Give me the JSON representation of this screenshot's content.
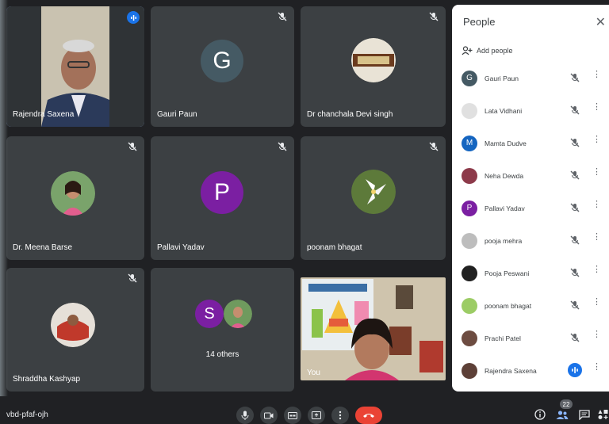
{
  "tiles": [
    {
      "name": "Rajendra Saxena",
      "state": "speaking"
    },
    {
      "name": "Gauri Paun",
      "initial": "G",
      "color": "#455a64"
    },
    {
      "name": "Dr chanchala Devi singh"
    },
    {
      "name": "Dr. Meena Barse"
    },
    {
      "name": "Pallavi Yadav",
      "initial": "P",
      "color": "#7b1fa2"
    },
    {
      "name": "poonam bhagat"
    },
    {
      "name": "Shraddha Kashyap"
    },
    {
      "name": "14 others",
      "initial": "S",
      "color": "#7b1fa2"
    },
    {
      "name": "You"
    }
  ],
  "people_panel": {
    "title": "People",
    "add_label": "Add people",
    "participants": [
      {
        "name": "Gauri Paun",
        "initial": "G",
        "color": "#455a64",
        "muted": true
      },
      {
        "name": "Lata Vidhani",
        "initial": "",
        "color": "#e0e0e0",
        "muted": true
      },
      {
        "name": "Mamta Dudve",
        "initial": "M",
        "color": "#1565c0",
        "muted": true
      },
      {
        "name": "Neha Dewda",
        "initial": "",
        "color": "#8d3a4a",
        "muted": true
      },
      {
        "name": "Pallavi Yadav",
        "initial": "P",
        "color": "#7b1fa2",
        "muted": true
      },
      {
        "name": "pooja mehra",
        "initial": "",
        "color": "#bdbdbd",
        "muted": true
      },
      {
        "name": "Pooja Peswani",
        "initial": "",
        "color": "#212121",
        "muted": true
      },
      {
        "name": "poonam bhagat",
        "initial": "",
        "color": "#9ccc65",
        "muted": true
      },
      {
        "name": "Prachi Patel",
        "initial": "",
        "color": "#6d4c41",
        "muted": true
      },
      {
        "name": "Rajendra Saxena",
        "initial": "",
        "color": "#5d4037",
        "muted": false
      }
    ]
  },
  "bottom_bar": {
    "meeting_code": "vbd-pfaf-ojh",
    "participant_count": "22"
  },
  "colors": {
    "background": "#202124",
    "tile": "#3c4043",
    "accent": "#1a73e8",
    "end_call": "#ea4335"
  }
}
